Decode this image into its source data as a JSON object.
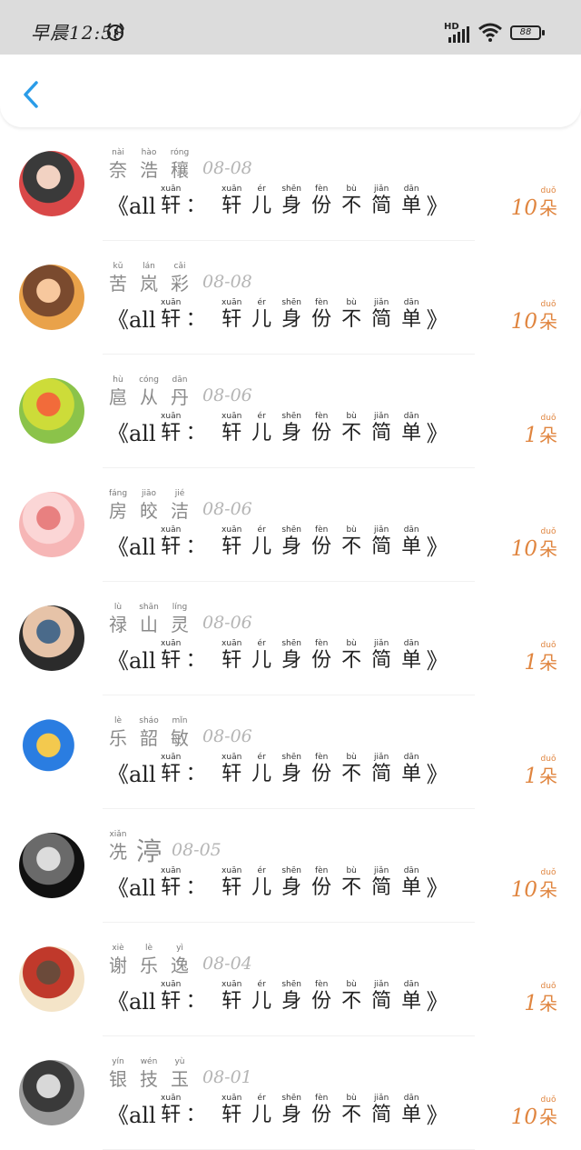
{
  "status_bar": {
    "time": "早晨12:58",
    "network": "HD",
    "battery": "88"
  },
  "header": {
    "back_icon": "chevron-left-icon",
    "accent_color": "#2a9ce8"
  },
  "title_prefix": "《all",
  "title_suffix": "》",
  "title_colon": "：",
  "title_chars": [
    {
      "py": "xuān",
      "hz": "轩"
    },
    {
      "py": "xuān",
      "hz": "轩"
    },
    {
      "py": "ér",
      "hz": "儿"
    },
    {
      "py": "shēn",
      "hz": "身"
    },
    {
      "py": "fèn",
      "hz": "份"
    },
    {
      "py": "bù",
      "hz": "不"
    },
    {
      "py": "jiǎn",
      "hz": "简"
    },
    {
      "py": "dān",
      "hz": "单"
    }
  ],
  "count_unit": {
    "py": "duǒ",
    "hz": "朵"
  },
  "count_color": "#e0853f",
  "rows": [
    {
      "name": [
        {
          "py": "nài",
          "hz": "奈"
        },
        {
          "py": "hào",
          "hz": "浩"
        },
        {
          "py": "róng",
          "hz": "穰"
        }
      ],
      "date": "08-08",
      "count": "10",
      "avatar": [
        "#d94848",
        "#3a3a3a",
        "#f2d2c2"
      ]
    },
    {
      "name": [
        {
          "py": "kǔ",
          "hz": "苦"
        },
        {
          "py": "lán",
          "hz": "岚"
        },
        {
          "py": "cǎi",
          "hz": "彩"
        }
      ],
      "date": "08-08",
      "count": "10",
      "avatar": [
        "#e9a24a",
        "#7a4a2e",
        "#f7c89e"
      ]
    },
    {
      "name": [
        {
          "py": "hù",
          "hz": "扈"
        },
        {
          "py": "cóng",
          "hz": "从"
        },
        {
          "py": "dān",
          "hz": "丹"
        }
      ],
      "date": "08-06",
      "count": "1",
      "avatar": [
        "#8bc34a",
        "#cddc39",
        "#f26b3a"
      ]
    },
    {
      "name": [
        {
          "py": "fáng",
          "hz": "房"
        },
        {
          "py": "jiāo",
          "hz": "皎"
        },
        {
          "py": "jié",
          "hz": "洁"
        }
      ],
      "date": "08-06",
      "count": "10",
      "avatar": [
        "#f6b6b6",
        "#fbd6d6",
        "#e88080"
      ]
    },
    {
      "name": [
        {
          "py": "lù",
          "hz": "禄"
        },
        {
          "py": "shān",
          "hz": "山"
        },
        {
          "py": "líng",
          "hz": "灵"
        }
      ],
      "date": "08-06",
      "count": "1",
      "avatar": [
        "#2b2b2b",
        "#e6c3a8",
        "#4a6a8a"
      ]
    },
    {
      "name": [
        {
          "py": "lè",
          "hz": "乐"
        },
        {
          "py": "sháo",
          "hz": "韶"
        },
        {
          "py": "mǐn",
          "hz": "敏"
        }
      ],
      "date": "08-06",
      "count": "1",
      "avatar": [
        "#ffffff",
        "#2a7de1",
        "#f3c94e"
      ]
    },
    {
      "name": [
        {
          "py": "xiǎn",
          "hz": "冼"
        },
        {
          "py": "",
          "hz": "渟",
          "big": true
        }
      ],
      "date": "08-05",
      "count": "10",
      "avatar": [
        "#111111",
        "#6a6a6a",
        "#dcdcdc"
      ]
    },
    {
      "name": [
        {
          "py": "xiè",
          "hz": "谢"
        },
        {
          "py": "lè",
          "hz": "乐"
        },
        {
          "py": "yì",
          "hz": "逸"
        }
      ],
      "date": "08-04",
      "count": "1",
      "avatar": [
        "#f4e4c8",
        "#c0392b",
        "#6b4a3a"
      ]
    },
    {
      "name": [
        {
          "py": "yín",
          "hz": "银"
        },
        {
          "py": "wén",
          "hz": "技"
        },
        {
          "py": "yù",
          "hz": "玉"
        }
      ],
      "date": "08-01",
      "count": "10",
      "avatar": [
        "#9a9a9a",
        "#3a3a3a",
        "#d8d8d8"
      ]
    }
  ]
}
